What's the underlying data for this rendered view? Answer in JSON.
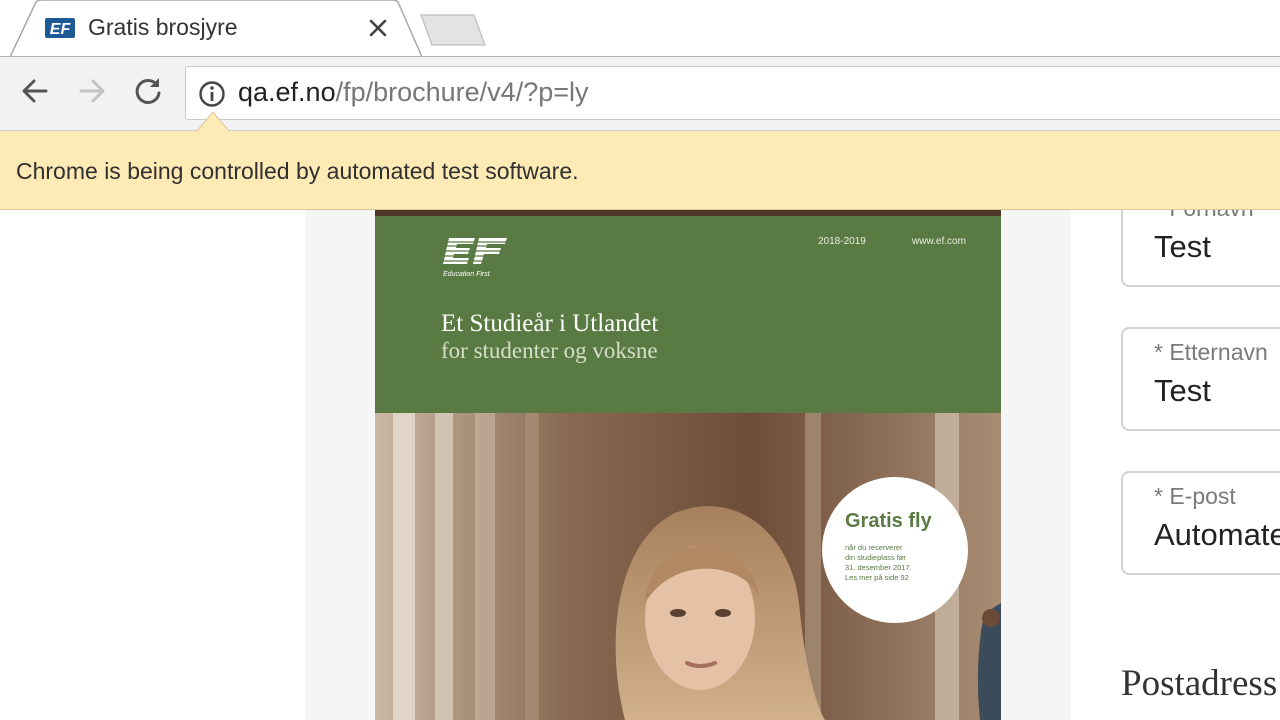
{
  "browser": {
    "tab": {
      "title": "Gratis brosjyre",
      "favicon": "ef-logo-icon",
      "close_icon": "close-icon"
    },
    "new_tab_icon": "new-tab-icon",
    "nav": {
      "back_icon": "back-arrow-icon",
      "forward_icon": "forward-arrow-icon",
      "reload_icon": "reload-icon"
    },
    "address": {
      "host": "qa.ef.no",
      "path": "/fp/brochure/v4/?p=ly",
      "site_info_icon": "info-icon"
    },
    "infobar": {
      "message": "Chrome is being controlled by automated test software."
    }
  },
  "brochure": {
    "years": "2018-2019",
    "website": "www.ef.com",
    "logo_caption": "Education First",
    "title": "Et Studieår i Utlandet",
    "subtitle": "for studenter og voksne",
    "badge": {
      "title": "Gratis fly",
      "lines": [
        "når du reserverer",
        "din studieplass før",
        "31. desember 2017.",
        "Les mer på side 92"
      ]
    }
  },
  "form": {
    "fields": [
      {
        "label": "* Fornavn",
        "value": "Test"
      },
      {
        "label": "* Etternavn",
        "value": "Test"
      },
      {
        "label": "* E-post",
        "value": "Automate"
      }
    ],
    "section_heading": "Postadress"
  },
  "colors": {
    "brochure_green": "#5a7a43",
    "infobar_bg": "#fdeab5",
    "toolbar_bg": "#f2f2f2"
  }
}
